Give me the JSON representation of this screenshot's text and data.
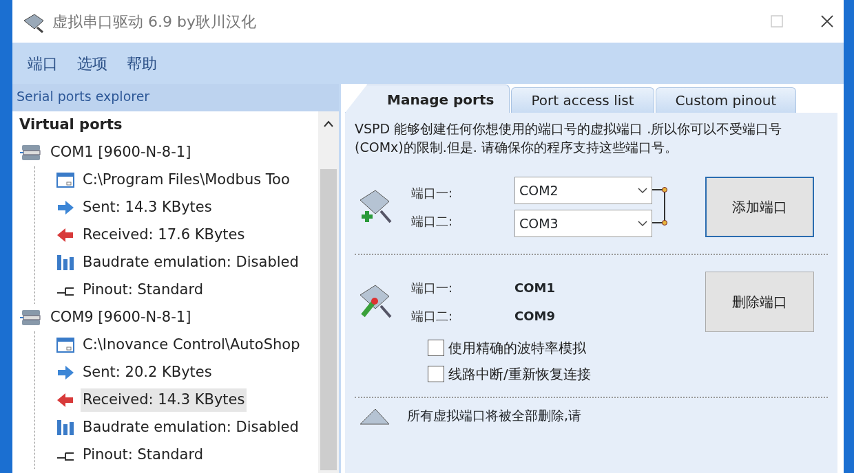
{
  "window": {
    "title": "虚拟串口驱动 6.9 by耿川汉化"
  },
  "menu": [
    "端口",
    "选项",
    "帮助"
  ],
  "explorer": {
    "title": "Serial ports explorer",
    "root": "Virtual ports",
    "ports": [
      {
        "label": "COM1 [9600-N-8-1]",
        "children": [
          {
            "kind": "app",
            "label": "C:\\Program Files\\Modbus Too",
            "selected": false
          },
          {
            "kind": "sent",
            "label": "Sent: 14.3 KBytes",
            "selected": false
          },
          {
            "kind": "received",
            "label": "Received: 17.6 KBytes",
            "selected": false
          },
          {
            "kind": "baudrate",
            "label": "Baudrate emulation: Disabled",
            "selected": false
          },
          {
            "kind": "pinout",
            "label": "Pinout: Standard",
            "selected": false
          }
        ]
      },
      {
        "label": "COM9 [9600-N-8-1]",
        "children": [
          {
            "kind": "app",
            "label": "C:\\Inovance Control\\AutoShop",
            "selected": false
          },
          {
            "kind": "sent",
            "label": "Sent: 20.2 KBytes",
            "selected": false
          },
          {
            "kind": "received",
            "label": "Received: 14.3 KBytes",
            "selected": true
          },
          {
            "kind": "baudrate",
            "label": "Baudrate emulation: Disabled",
            "selected": false
          },
          {
            "kind": "pinout",
            "label": "Pinout: Standard",
            "selected": false
          }
        ]
      }
    ]
  },
  "tabs": [
    {
      "label": "Manage ports",
      "selected": true
    },
    {
      "label": "Port access list",
      "selected": false
    },
    {
      "label": "Custom pinout",
      "selected": false
    }
  ],
  "description": "VSPD 能够创建任何你想使用的端口号的虚拟端口 .所以你可以不受端口号(COMx)的限制.但是. 请确保你的程序支持这些端口号。",
  "add_section": {
    "label_1": "端口一:",
    "label_2": "端口二:",
    "value_1": "COM2",
    "value_2": "COM3",
    "button": "添加端口"
  },
  "delete_section": {
    "label_1": "端口一:",
    "label_2": "端口二:",
    "value_1": "COM1",
    "value_2": "COM9",
    "button": "删除端口",
    "options": [
      {
        "label": "使用精确的波特率模拟",
        "checked": false
      },
      {
        "label": "线路中断/重新恢复连接",
        "checked": false
      }
    ]
  },
  "remove_all_section": {
    "text": "所有虚拟端口将被全部删除,请"
  }
}
